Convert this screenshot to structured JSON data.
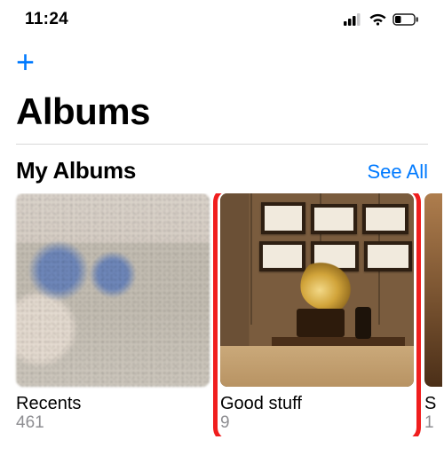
{
  "status_bar": {
    "time": "11:24"
  },
  "header": {
    "add_glyph": "+",
    "page_title": "Albums"
  },
  "section": {
    "title": "My Albums",
    "see_all": "See All"
  },
  "albums": [
    {
      "name": "Recents",
      "count": "461",
      "redacted": true,
      "highlight": false
    },
    {
      "name": "Good stuff",
      "count": "9",
      "redacted": false,
      "highlight": true
    },
    {
      "name": "S",
      "count": "1",
      "redacted": false,
      "highlight": false
    }
  ],
  "colors": {
    "accent": "#007aff",
    "highlight": "#f01e1e",
    "muted": "#8e8e92"
  }
}
